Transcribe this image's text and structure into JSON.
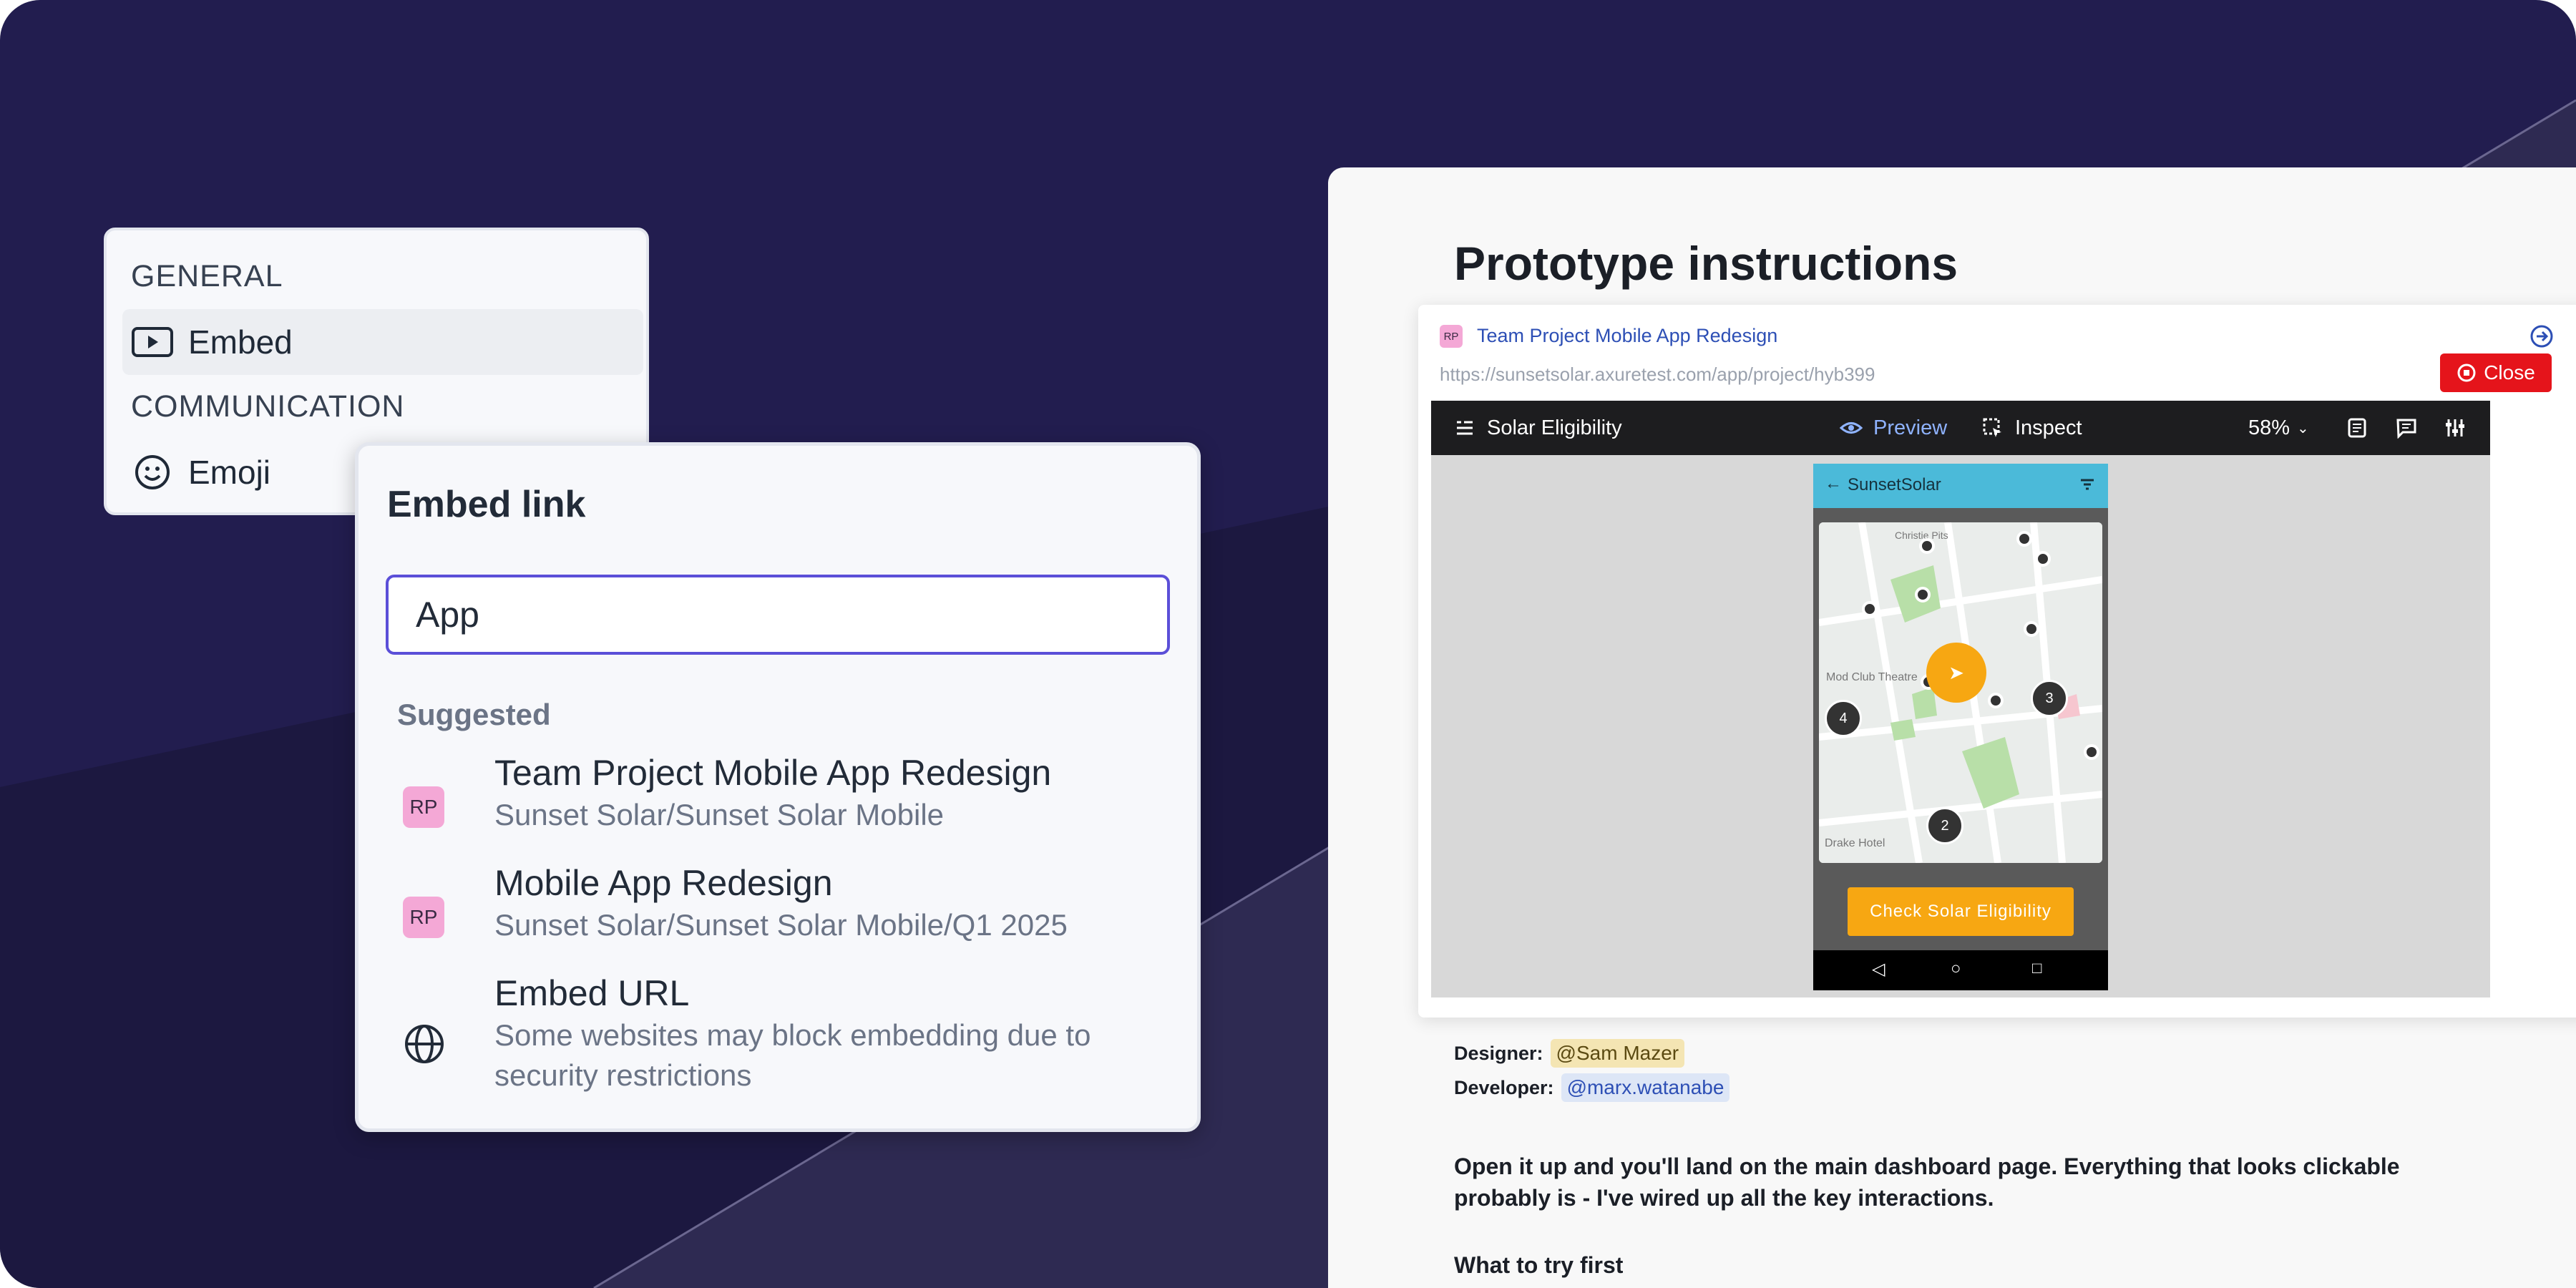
{
  "menu": {
    "general_heading": "GENERAL",
    "embed_label": "Embed",
    "communication_heading": "COMMUNICATION",
    "emoji_label": "Emoji"
  },
  "embed_popover": {
    "title": "Embed link",
    "input_value": "App",
    "suggested_label": "Suggested",
    "suggestions": [
      {
        "badge": "RP",
        "title": "Team Project Mobile App Redesign",
        "subtitle": "Sunset Solar/Sunset Solar Mobile"
      },
      {
        "badge": "RP",
        "title": "Mobile App Redesign",
        "subtitle": "Sunset Solar/Sunset Solar Mobile/Q1 2025"
      },
      {
        "icon": "globe-icon",
        "title": "Embed URL",
        "subtitle": "Some websites may block embedding due to security restrictions"
      }
    ]
  },
  "doc": {
    "title": "Prototype instructions",
    "embed_card": {
      "badge": "RP",
      "project_title": "Team Project Mobile App Redesign",
      "url": "https://sunsetsolar.axuretest.com/app/project/hyb399",
      "close_label": "Close"
    },
    "toolbar": {
      "page_name": "Solar Eligibility",
      "preview_label": "Preview",
      "inspect_label": "Inspect",
      "zoom": "58%"
    },
    "phone": {
      "app_name": "SunsetSolar",
      "cta": "Check Solar Eligibility",
      "map_labels": [
        "Mod Club Theatre",
        "Drake Hotel",
        "Christie Pits"
      ],
      "cluster_counts": [
        "4",
        "3",
        "2"
      ]
    },
    "designer_label": "Designer:",
    "designer": "@Sam Mazer",
    "developer_label": "Developer:",
    "developer": "@marx.watanabe",
    "paragraph": "Open it up and you'll land on the main dashboard page. Everything that looks clickable probably is - I've wired up all the key interactions.",
    "what_to_try": "What to try first"
  },
  "colors": {
    "background": "#221d4f",
    "accent": "#5b4fd8",
    "badge": "#f4a8d6",
    "close": "#e5141b",
    "cta": "#f7a712",
    "phone_header": "#4bbad9"
  }
}
